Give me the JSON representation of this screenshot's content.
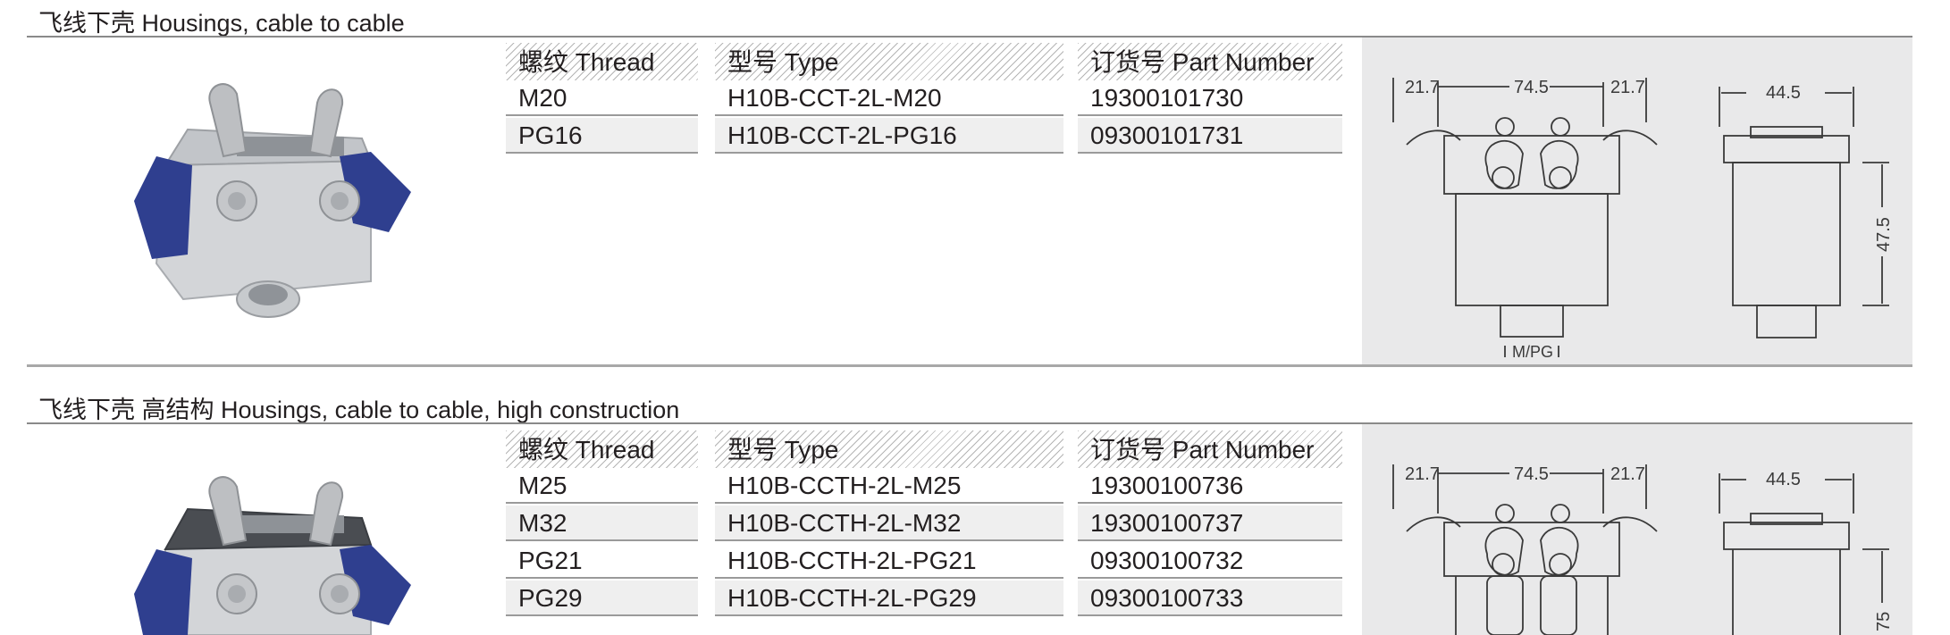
{
  "sections": [
    {
      "title": "飞线下壳 Housings, cable to cable",
      "headers": {
        "thread": "螺纹 Thread",
        "type": "型号 Type",
        "part": "订货号 Part Number"
      },
      "rows": [
        {
          "thread": "M20",
          "type": "H10B-CCT-2L-M20",
          "part": "19300101730"
        },
        {
          "thread": "PG16",
          "type": "H10B-CCT-2L-PG16",
          "part": "09300101731"
        }
      ],
      "drawing": {
        "dim_left": "21.7",
        "dim_center": "74.5",
        "dim_right": "21.7",
        "dim_side_width": "44.5",
        "dim_height": "47.5",
        "dim_thread": "M/PG"
      }
    },
    {
      "title": "飞线下壳 高结构 Housings, cable to cable, high construction",
      "headers": {
        "thread": "螺纹 Thread",
        "type": "型号 Type",
        "part": "订货号 Part Number"
      },
      "rows": [
        {
          "thread": "M25",
          "type": "H10B-CCTH-2L-M25",
          "part": "19300100736"
        },
        {
          "thread": "M32",
          "type": "H10B-CCTH-2L-M32",
          "part": "19300100737"
        },
        {
          "thread": "PG21",
          "type": "H10B-CCTH-2L-PG21",
          "part": "09300100732"
        },
        {
          "thread": "PG29",
          "type": "H10B-CCTH-2L-PG29",
          "part": "09300100733"
        }
      ],
      "drawing": {
        "dim_left": "21.7",
        "dim_center": "74.5",
        "dim_right": "21.7",
        "dim_side_width": "44.5",
        "dim_height": "75"
      }
    }
  ],
  "colors": {
    "housing": "#d7d9db",
    "lever": "#2f3f8f",
    "drawing_bg": "#e9e9ea",
    "rule": "#8a8a8a"
  }
}
